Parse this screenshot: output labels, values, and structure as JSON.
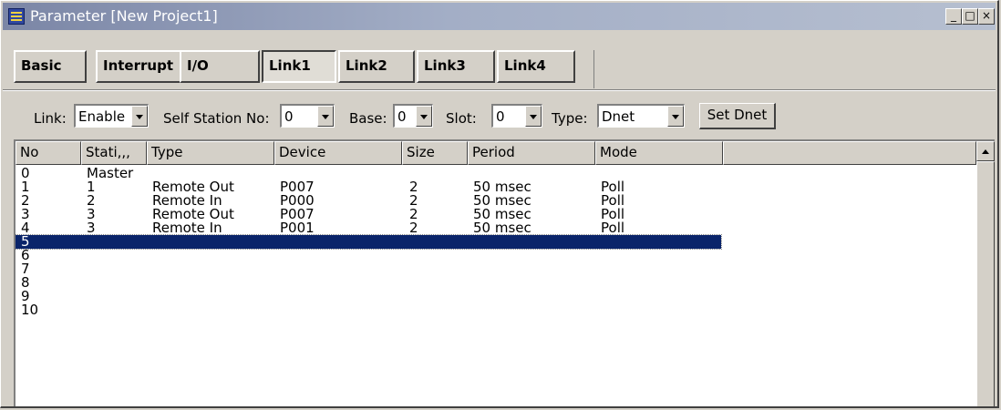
{
  "window": {
    "title": "Parameter [New Project1]",
    "buttons": {
      "minimize": "_",
      "maximize": "□",
      "close": "×"
    }
  },
  "tabs": [
    {
      "label": "Basic",
      "active": false
    },
    {
      "label": "Interrupt",
      "active": false
    },
    {
      "label": "I/O",
      "active": false
    },
    {
      "label": "Link1",
      "active": true
    },
    {
      "label": "Link2",
      "active": false
    },
    {
      "label": "Link3",
      "active": false
    },
    {
      "label": "Link4",
      "active": false
    }
  ],
  "toolbar": {
    "link_label": "Link:",
    "link_value": "Enable",
    "self_station_label": "Self Station No:",
    "self_station_value": "0",
    "base_label": "Base:",
    "base_value": "0",
    "slot_label": "Slot:",
    "slot_value": "0",
    "type_label": "Type:",
    "type_value": "Dnet",
    "set_dnet_label": "Set Dnet"
  },
  "table": {
    "columns": [
      "No",
      "Stati,,,",
      "Type",
      "Device",
      "Size",
      "Period",
      "Mode",
      ""
    ],
    "rows": [
      {
        "no": "0",
        "station": "Master",
        "type": "",
        "device": "",
        "size": "",
        "period": "",
        "mode": ""
      },
      {
        "no": "1",
        "station": "1",
        "type": "Remote Out",
        "device": "P007",
        "size": "2",
        "period": "50 msec",
        "mode": "Poll"
      },
      {
        "no": "2",
        "station": "2",
        "type": "Remote In",
        "device": "P000",
        "size": "2",
        "period": "50 msec",
        "mode": "Poll"
      },
      {
        "no": "3",
        "station": "3",
        "type": "Remote Out",
        "device": "P007",
        "size": "2",
        "period": "50 msec",
        "mode": "Poll"
      },
      {
        "no": "4",
        "station": "3",
        "type": "Remote In",
        "device": "P001",
        "size": "2",
        "period": "50 msec",
        "mode": "Poll"
      },
      {
        "no": "5",
        "station": "",
        "type": "",
        "device": "",
        "size": "",
        "period": "",
        "mode": ""
      },
      {
        "no": "6",
        "station": "",
        "type": "",
        "device": "",
        "size": "",
        "period": "",
        "mode": ""
      },
      {
        "no": "7",
        "station": "",
        "type": "",
        "device": "",
        "size": "",
        "period": "",
        "mode": ""
      },
      {
        "no": "8",
        "station": "",
        "type": "",
        "device": "",
        "size": "",
        "period": "",
        "mode": ""
      },
      {
        "no": "9",
        "station": "",
        "type": "",
        "device": "",
        "size": "",
        "period": "",
        "mode": ""
      },
      {
        "no": "10",
        "station": "",
        "type": "",
        "device": "",
        "size": "",
        "period": "",
        "mode": ""
      }
    ],
    "selected_row": 5
  },
  "colors": {
    "selection": "#0a246a",
    "titlebar": "#8a95b2"
  }
}
